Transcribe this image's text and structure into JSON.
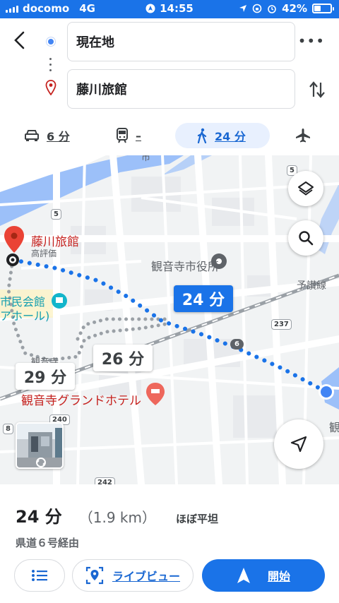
{
  "status": {
    "carrier": "docomo",
    "network": "4G",
    "time": "14:55",
    "battery": "42%",
    "battery_level": 0.42
  },
  "header": {
    "origin": "現在地",
    "destination": "藤川旅館"
  },
  "modes": [
    {
      "name": "car",
      "label": "6 分"
    },
    {
      "name": "transit",
      "label": "–"
    },
    {
      "name": "walk",
      "label": "24 分",
      "selected": true
    },
    {
      "name": "flight",
      "label": ""
    }
  ],
  "map": {
    "dest_name": "藤川旅館",
    "dest_sub": "高評価",
    "city_hall": "観音寺市役所",
    "line_name": "予讃線",
    "civic_center": "市民会館",
    "civic_center_sub": "アホール)",
    "hotel": "観音寺グランドホテル",
    "edge_text": "観",
    "small_label": "観音寺",
    "top_fragment": "市",
    "road_shields": [
      "5",
      "5",
      "6",
      "237",
      "8",
      "240",
      "242"
    ],
    "route_bubbles": {
      "primary": "24 分",
      "alt1": "26 分",
      "alt2": "29 分"
    },
    "colors": {
      "route": "#1a73e8",
      "alt_route": "#9aa0a6",
      "pin": "#ea4335",
      "water": "#9cc0f9"
    }
  },
  "summary": {
    "duration": "24 分",
    "distance": "（1.9 km）",
    "terrain": "ほぼ平坦",
    "via": "県道６号経由"
  },
  "buttons": {
    "steps_icon": "list-icon",
    "live_view": "ライブビュー",
    "start": "開始"
  }
}
